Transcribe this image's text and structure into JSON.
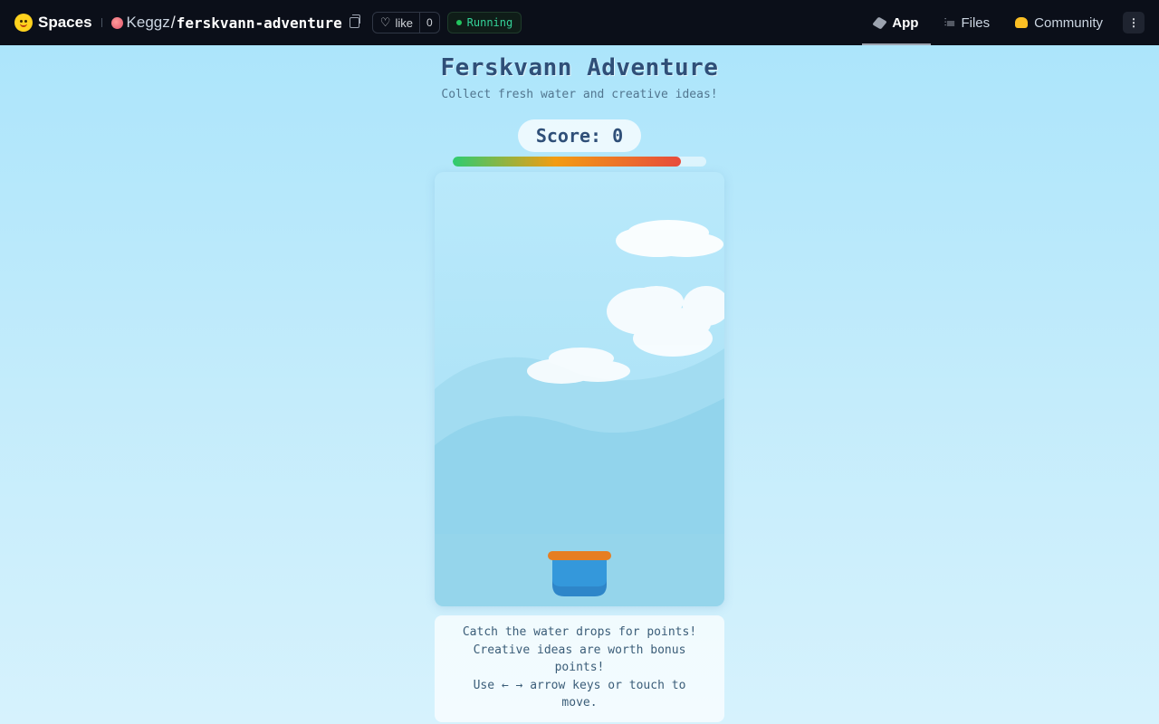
{
  "header": {
    "spaces_label": "Spaces",
    "owner": "Keggz",
    "separator": "/",
    "repo": "ferskvann-adventure",
    "like_label": "like",
    "like_count": "0",
    "status": "Running",
    "tabs": [
      {
        "label": "App",
        "icon": "cube-icon",
        "active": true
      },
      {
        "label": "Files",
        "icon": "files-icon",
        "active": false
      },
      {
        "label": "Community",
        "icon": "community-icon",
        "active": false
      }
    ],
    "more_icon": "⋮"
  },
  "game": {
    "title": "Ferskvann Adventure",
    "subtitle": "Collect fresh water and creative ideas!",
    "score_label": "Score:",
    "score": "0",
    "progress_fraction": 0.9,
    "progress_colors": [
      "#2ecc71",
      "#f39c12",
      "#e74c3c"
    ],
    "bucket_color": "#3498db",
    "bucket_rim_color": "#e67e22",
    "instructions": [
      "Catch the water drops for points!",
      "Creative ideas are worth bonus",
      "points!",
      "Use ← → arrow keys or touch to",
      "move."
    ]
  }
}
